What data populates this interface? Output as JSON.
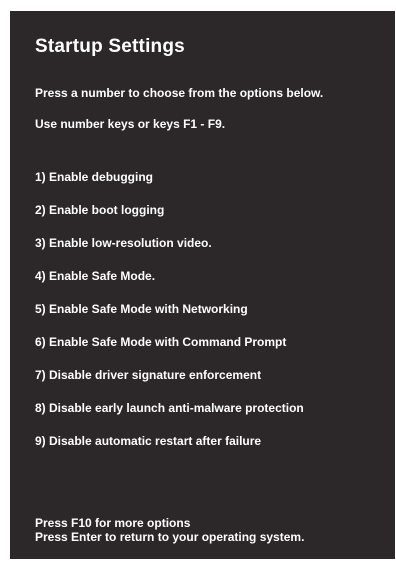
{
  "title": "Startup Settings",
  "instructions": [
    "Press a number to choose from the options below.",
    "Use number keys or keys F1 - F9."
  ],
  "options": [
    "1) Enable debugging",
    "2) Enable boot logging",
    "3) Enable low-resolution video.",
    "4) Enable Safe Mode.",
    "5) Enable Safe Mode with Networking",
    "6) Enable Safe Mode with Command Prompt",
    "7) Disable driver signature enforcement",
    "8) Disable early launch anti-malware protection",
    "9) Disable automatic restart after failure"
  ],
  "footer": [
    "Press F10 for more options",
    "Press Enter to return to your operating system."
  ],
  "colors": {
    "background": "#2c2728",
    "text": "#ffffff"
  }
}
